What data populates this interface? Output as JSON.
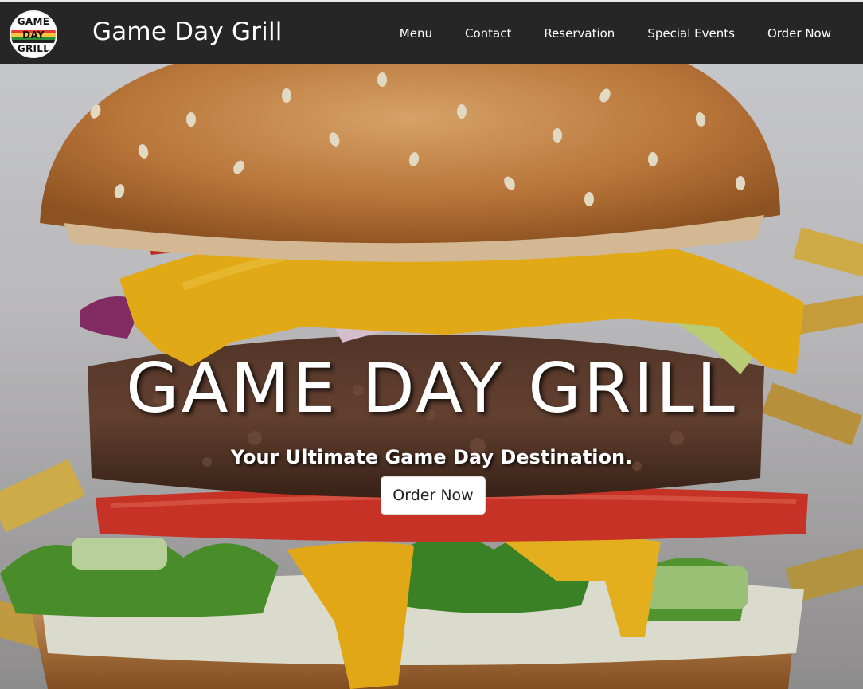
{
  "logo": {
    "line1": "GAME",
    "line2": "DAY",
    "line3": "GRILL",
    "stripe_colors": [
      "#e63b2e",
      "#f5c542",
      "#2e8b3a"
    ]
  },
  "brand": {
    "name": "Game Day Grill"
  },
  "nav": {
    "items": [
      "Menu",
      "Contact",
      "Reservation",
      "Special Events",
      "Order Now"
    ]
  },
  "hero": {
    "title": "GAME DAY GRILL",
    "subtitle": "Your Ultimate Game Day Destination.",
    "cta": "Order Now",
    "image": "burger-hero-image"
  },
  "colors": {
    "navbar": "#262626",
    "nav_text": "#ffffff",
    "button_bg": "#ffffff"
  }
}
